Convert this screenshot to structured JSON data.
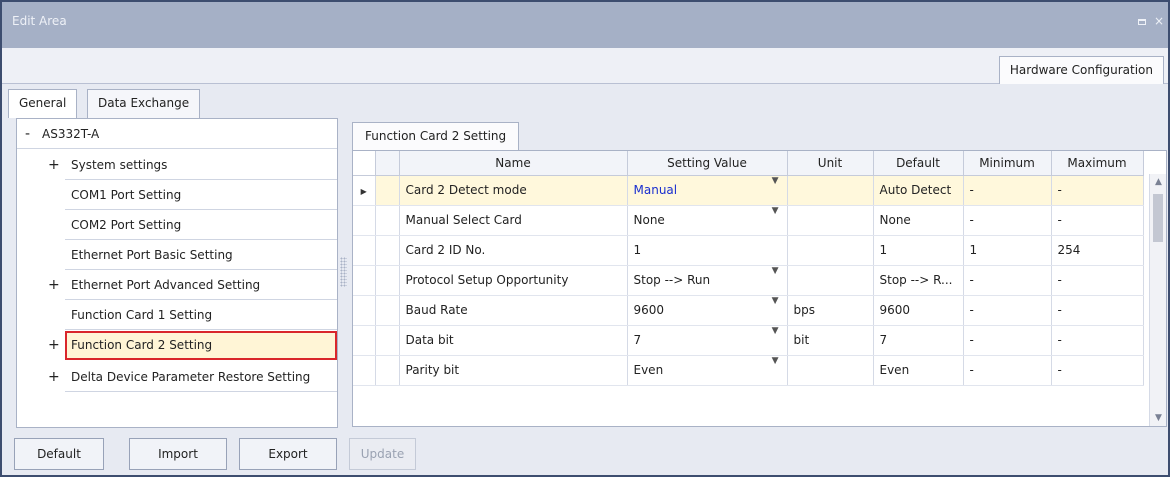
{
  "window": {
    "title": "Edit Area",
    "max_icon": "maximize-icon",
    "close_icon": "close-icon",
    "close_glyph": "×"
  },
  "top_tab": "Hardware Configuration",
  "left_tabs": [
    "General",
    "Data Exchange"
  ],
  "tree": {
    "root_expander": "-",
    "root": "AS332T-A",
    "items": [
      {
        "expander": "+",
        "label": "System settings"
      },
      {
        "expander": "",
        "label": "COM1 Port Setting"
      },
      {
        "expander": "",
        "label": "COM2 Port Setting"
      },
      {
        "expander": "",
        "label": "Ethernet Port Basic Setting"
      },
      {
        "expander": "+",
        "label": "Ethernet Port Advanced Setting"
      },
      {
        "expander": "",
        "label": "Function Card 1 Setting"
      },
      {
        "expander": "+",
        "label": "Function Card 2 Setting",
        "selected": true
      },
      {
        "expander": "+",
        "label": "Delta Device Parameter Restore Setting"
      }
    ]
  },
  "panel_tab": "Function Card 2 Setting",
  "grid": {
    "columns": [
      "Name",
      "Setting Value",
      "Unit",
      "Default",
      "Minimum",
      "Maximum"
    ],
    "rows": [
      {
        "name": "Card 2 Detect mode",
        "value": "Manual",
        "dropdown": true,
        "unit": "",
        "default": "Auto Detect",
        "min": "-",
        "max": "-"
      },
      {
        "name": "Manual Select Card",
        "value": "None",
        "dropdown": true,
        "unit": "",
        "default": "None",
        "min": "-",
        "max": "-"
      },
      {
        "name": "Card 2 ID No.",
        "value": "1",
        "dropdown": false,
        "unit": "",
        "default": "1",
        "min": "1",
        "max": "254"
      },
      {
        "name": "Protocol Setup Opportunity",
        "value": "Stop --> Run",
        "dropdown": true,
        "unit": "",
        "default": "Stop --> R...",
        "min": "-",
        "max": "-"
      },
      {
        "name": "Baud Rate",
        "value": "9600",
        "dropdown": true,
        "unit": "bps",
        "default": "9600",
        "min": "-",
        "max": "-"
      },
      {
        "name": "Data bit",
        "value": "7",
        "dropdown": true,
        "unit": "bit",
        "default": "7",
        "min": "-",
        "max": "-"
      },
      {
        "name": "Parity bit",
        "value": "Even",
        "dropdown": true,
        "unit": "",
        "default": "Even",
        "min": "-",
        "max": "-"
      }
    ],
    "active_row_marker": "▶"
  },
  "buttons": {
    "default": "Default",
    "import": "Import",
    "export": "Export",
    "update": "Update"
  },
  "colors": {
    "titlebar": "#a5b0c6",
    "selected_outline": "#d9262b",
    "active_row": "#fff8dc",
    "link_value": "#1a2fcf"
  }
}
